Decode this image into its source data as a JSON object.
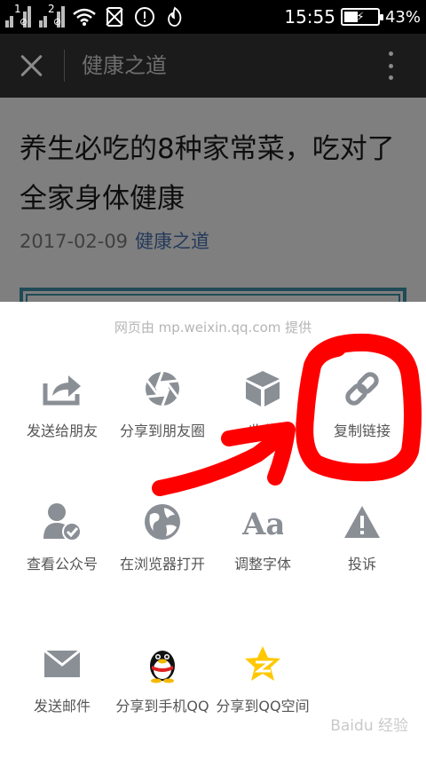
{
  "status_bar": {
    "sim1": "1",
    "sim2": "2",
    "time": "15:55",
    "battery_percent": "43%",
    "battery_level": 0.43,
    "icons": [
      "signal-icon",
      "signal-icon",
      "wifi-icon",
      "no-sim-icon",
      "alert-icon",
      "app-notification-icon",
      "battery-charging-icon"
    ]
  },
  "app_bar": {
    "title": "健康之道",
    "icons": [
      "close-icon",
      "more-vert-icon"
    ]
  },
  "article": {
    "title": "养生必吃的8种家常菜，吃对了全家身体健康",
    "date": "2017-02-09",
    "author": "健康之道"
  },
  "share_sheet": {
    "provider": "网页由 mp.weixin.qq.com 提供",
    "items": [
      {
        "label": "发送给朋友",
        "icon": "share-forward-icon"
      },
      {
        "label": "分享到朋友圈",
        "icon": "moments-aperture-icon"
      },
      {
        "label": "收藏",
        "icon": "favorite-cube-icon"
      },
      {
        "label": "复制链接",
        "icon": "link-icon"
      },
      {
        "label": "查看公众号",
        "icon": "official-account-icon"
      },
      {
        "label": "在浏览器打开",
        "icon": "globe-icon"
      },
      {
        "label": "调整字体",
        "icon": "font-size-icon"
      },
      {
        "label": "投诉",
        "icon": "warning-icon"
      },
      {
        "label": "发送邮件",
        "icon": "mail-icon"
      },
      {
        "label": "分享到手机QQ",
        "icon": "qq-penguin-icon"
      },
      {
        "label": "分享到QQ空间",
        "icon": "qzone-star-icon"
      }
    ]
  },
  "colors": {
    "annotation_red": "#ff0000",
    "icon_gray": "#8a8f96",
    "author_blue": "#253a5a"
  },
  "watermark": "Baidu 经验"
}
